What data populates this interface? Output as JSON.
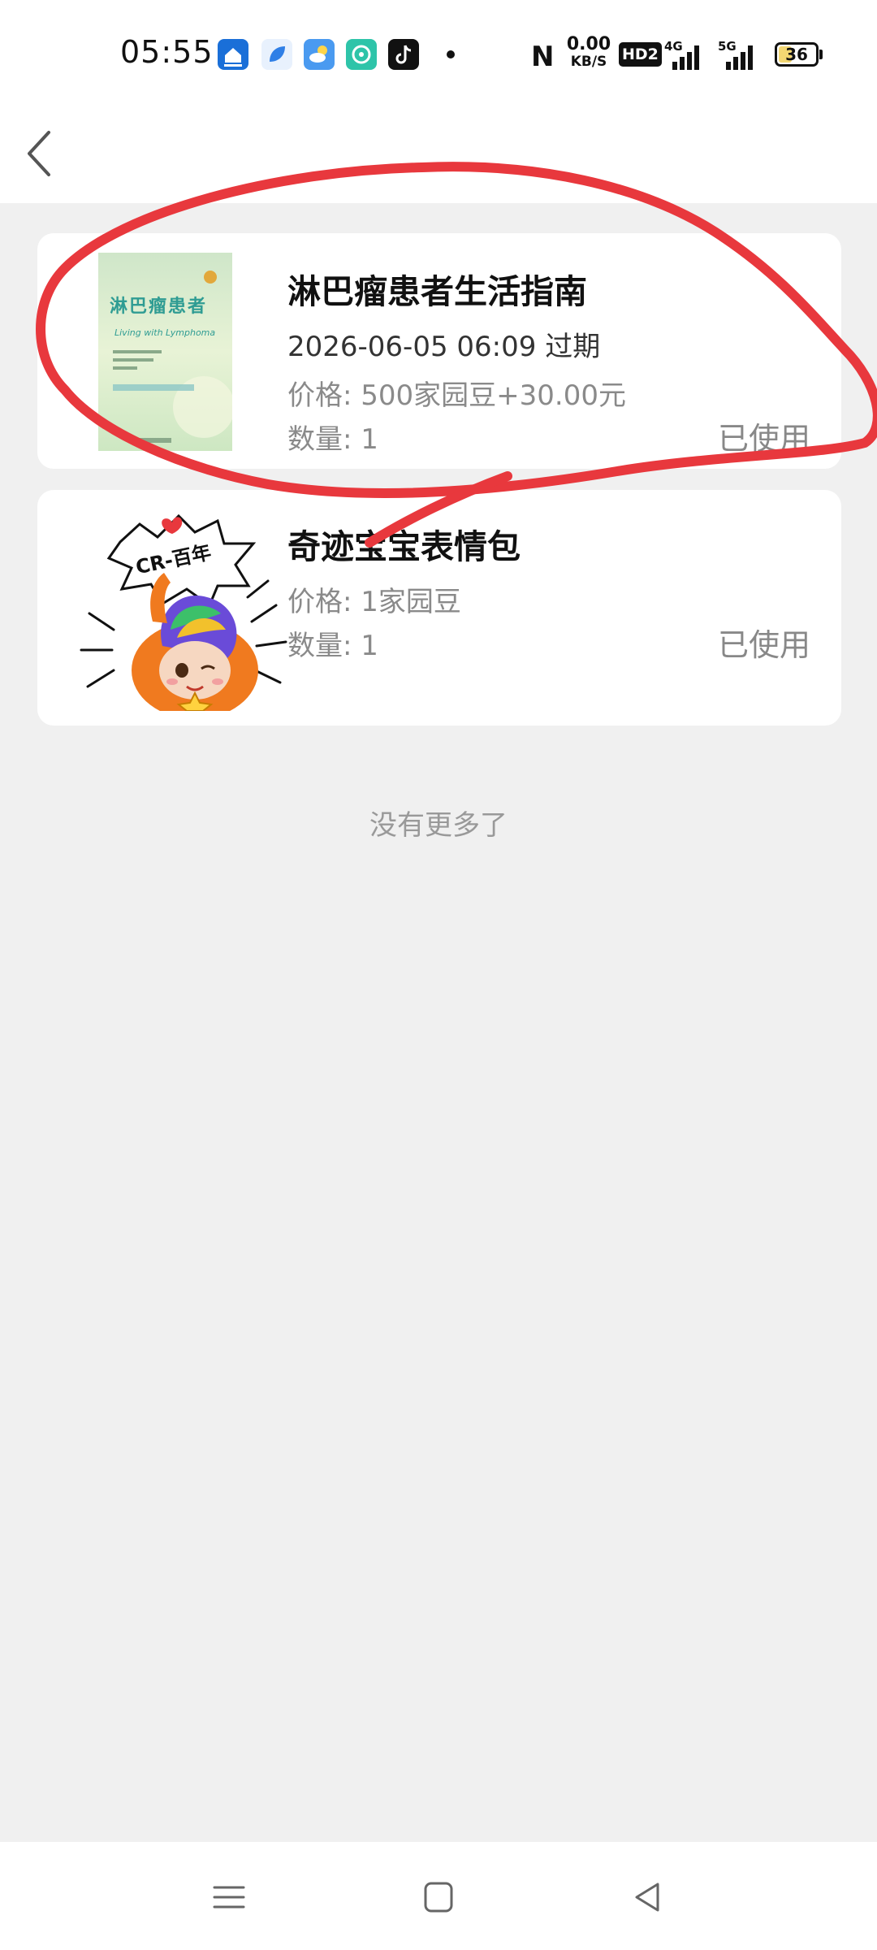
{
  "status_bar": {
    "time": "05:55",
    "speed_value": "0.00",
    "speed_unit": "KB/S",
    "hd_label": "HD2",
    "signal_4g": "4G",
    "signal_5g": "5G",
    "battery": "36",
    "app_icons": [
      "blue-house-icon",
      "blue-leaf-icon",
      "weather-icon",
      "teal-chat-icon",
      "tiktok-icon"
    ]
  },
  "orders": [
    {
      "title": "淋巴瘤患者生活指南",
      "expire": "2026-06-05 06:09 过期",
      "price_label": "价格:",
      "price": "500家园豆+30.00元",
      "qty_label": "数量:",
      "qty": "1",
      "status": "已使用",
      "cover_title": "淋巴瘤患者",
      "cover_subtitle": "Living with Lymphoma"
    },
    {
      "title": "奇迹宝宝表情包",
      "price_label": "价格:",
      "price": "1家园豆",
      "qty_label": "数量:",
      "qty": "1",
      "status": "已使用",
      "sticker_text": "CR-百年"
    }
  ],
  "footer_text": "没有更多了",
  "colors": {
    "background": "#f0f0f0",
    "card": "#ffffff",
    "annotation": "#e8383d",
    "muted_text": "#8a8a8a"
  }
}
